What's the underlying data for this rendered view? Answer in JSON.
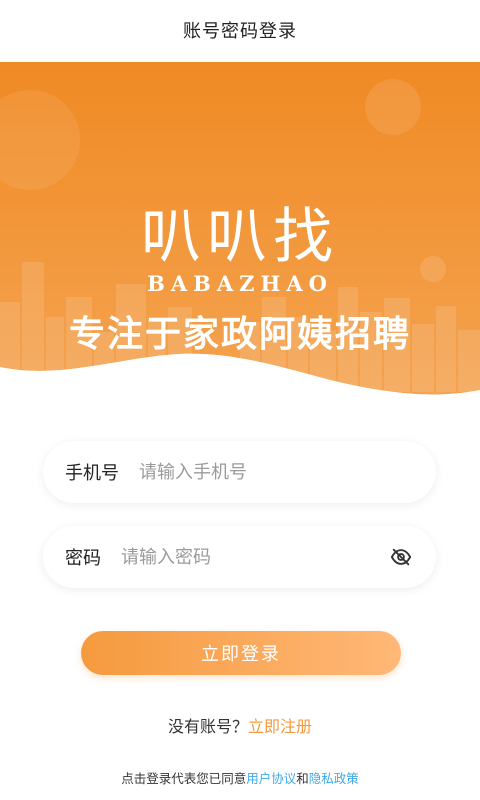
{
  "header": {
    "title": "账号密码登录"
  },
  "banner": {
    "brand_chinese": "叭叭找",
    "brand_english": "BABAZHAO",
    "slogan": "专注于家政阿姨招聘",
    "colors": {
      "top": "#f08a24",
      "bottom": "#f4a04e"
    }
  },
  "form": {
    "phone": {
      "label": "手机号",
      "placeholder": "请输入手机号",
      "value": ""
    },
    "password": {
      "label": "密码",
      "placeholder": "请输入密码",
      "value": "",
      "toggle_icon": "eye-off-icon"
    },
    "login_button_label": "立即登录"
  },
  "register": {
    "prompt": "没有账号？",
    "link": "立即注册"
  },
  "agreement": {
    "prefix": "点击登录代表您已同意",
    "user_agreement": "用户协议",
    "conjunction": "和",
    "privacy_policy": "隐私政策"
  },
  "accent_colors": {
    "orange": "#f59a3e",
    "link_blue": "#3fa9e8"
  }
}
